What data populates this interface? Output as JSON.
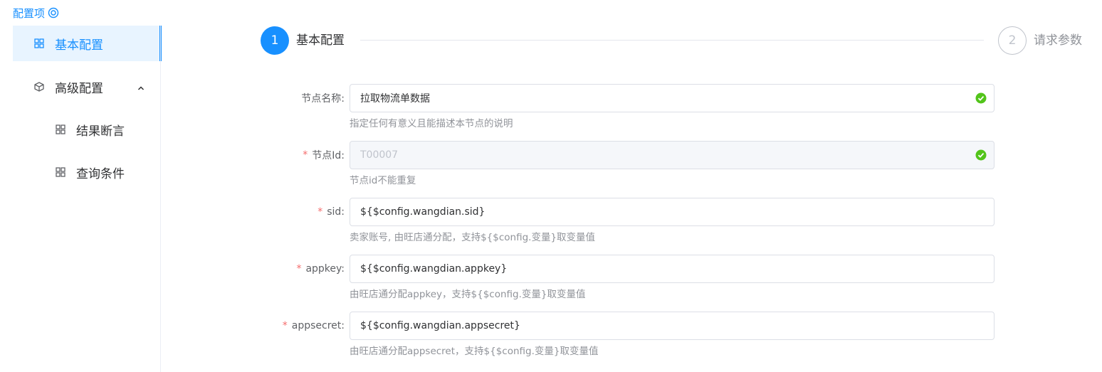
{
  "header": {
    "title": "配置项"
  },
  "sidebar": {
    "items": [
      {
        "label": "基本配置"
      },
      {
        "label": "高级配置"
      },
      {
        "label": "结果断言"
      },
      {
        "label": "查询条件"
      }
    ]
  },
  "steps": [
    {
      "number": "1",
      "title": "基本配置"
    },
    {
      "number": "2",
      "title": "请求参数"
    }
  ],
  "form": {
    "node_name": {
      "label": "节点名称:",
      "value": "拉取物流单数据",
      "help": "指定任何有意义且能描述本节点的说明"
    },
    "node_id": {
      "label": "节点Id:",
      "value": "T00007",
      "help": "节点id不能重复"
    },
    "sid": {
      "label": "sid:",
      "value": "${$config.wangdian.sid}",
      "help": "卖家账号, 由旺店通分配，支持${$config.变量}取变量值"
    },
    "appkey": {
      "label": "appkey:",
      "value": "${$config.wangdian.appkey}",
      "help": "由旺店通分配appkey，支持${$config.变量}取变量值"
    },
    "appsecret": {
      "label": "appsecret:",
      "value": "${$config.wangdian.appsecret}",
      "help": "由旺店通分配appsecret，支持${$config.变量}取变量值"
    },
    "required_mark": "*"
  },
  "colors": {
    "primary": "#1890ff",
    "success": "#52c41a",
    "required": "#f56c6c"
  }
}
